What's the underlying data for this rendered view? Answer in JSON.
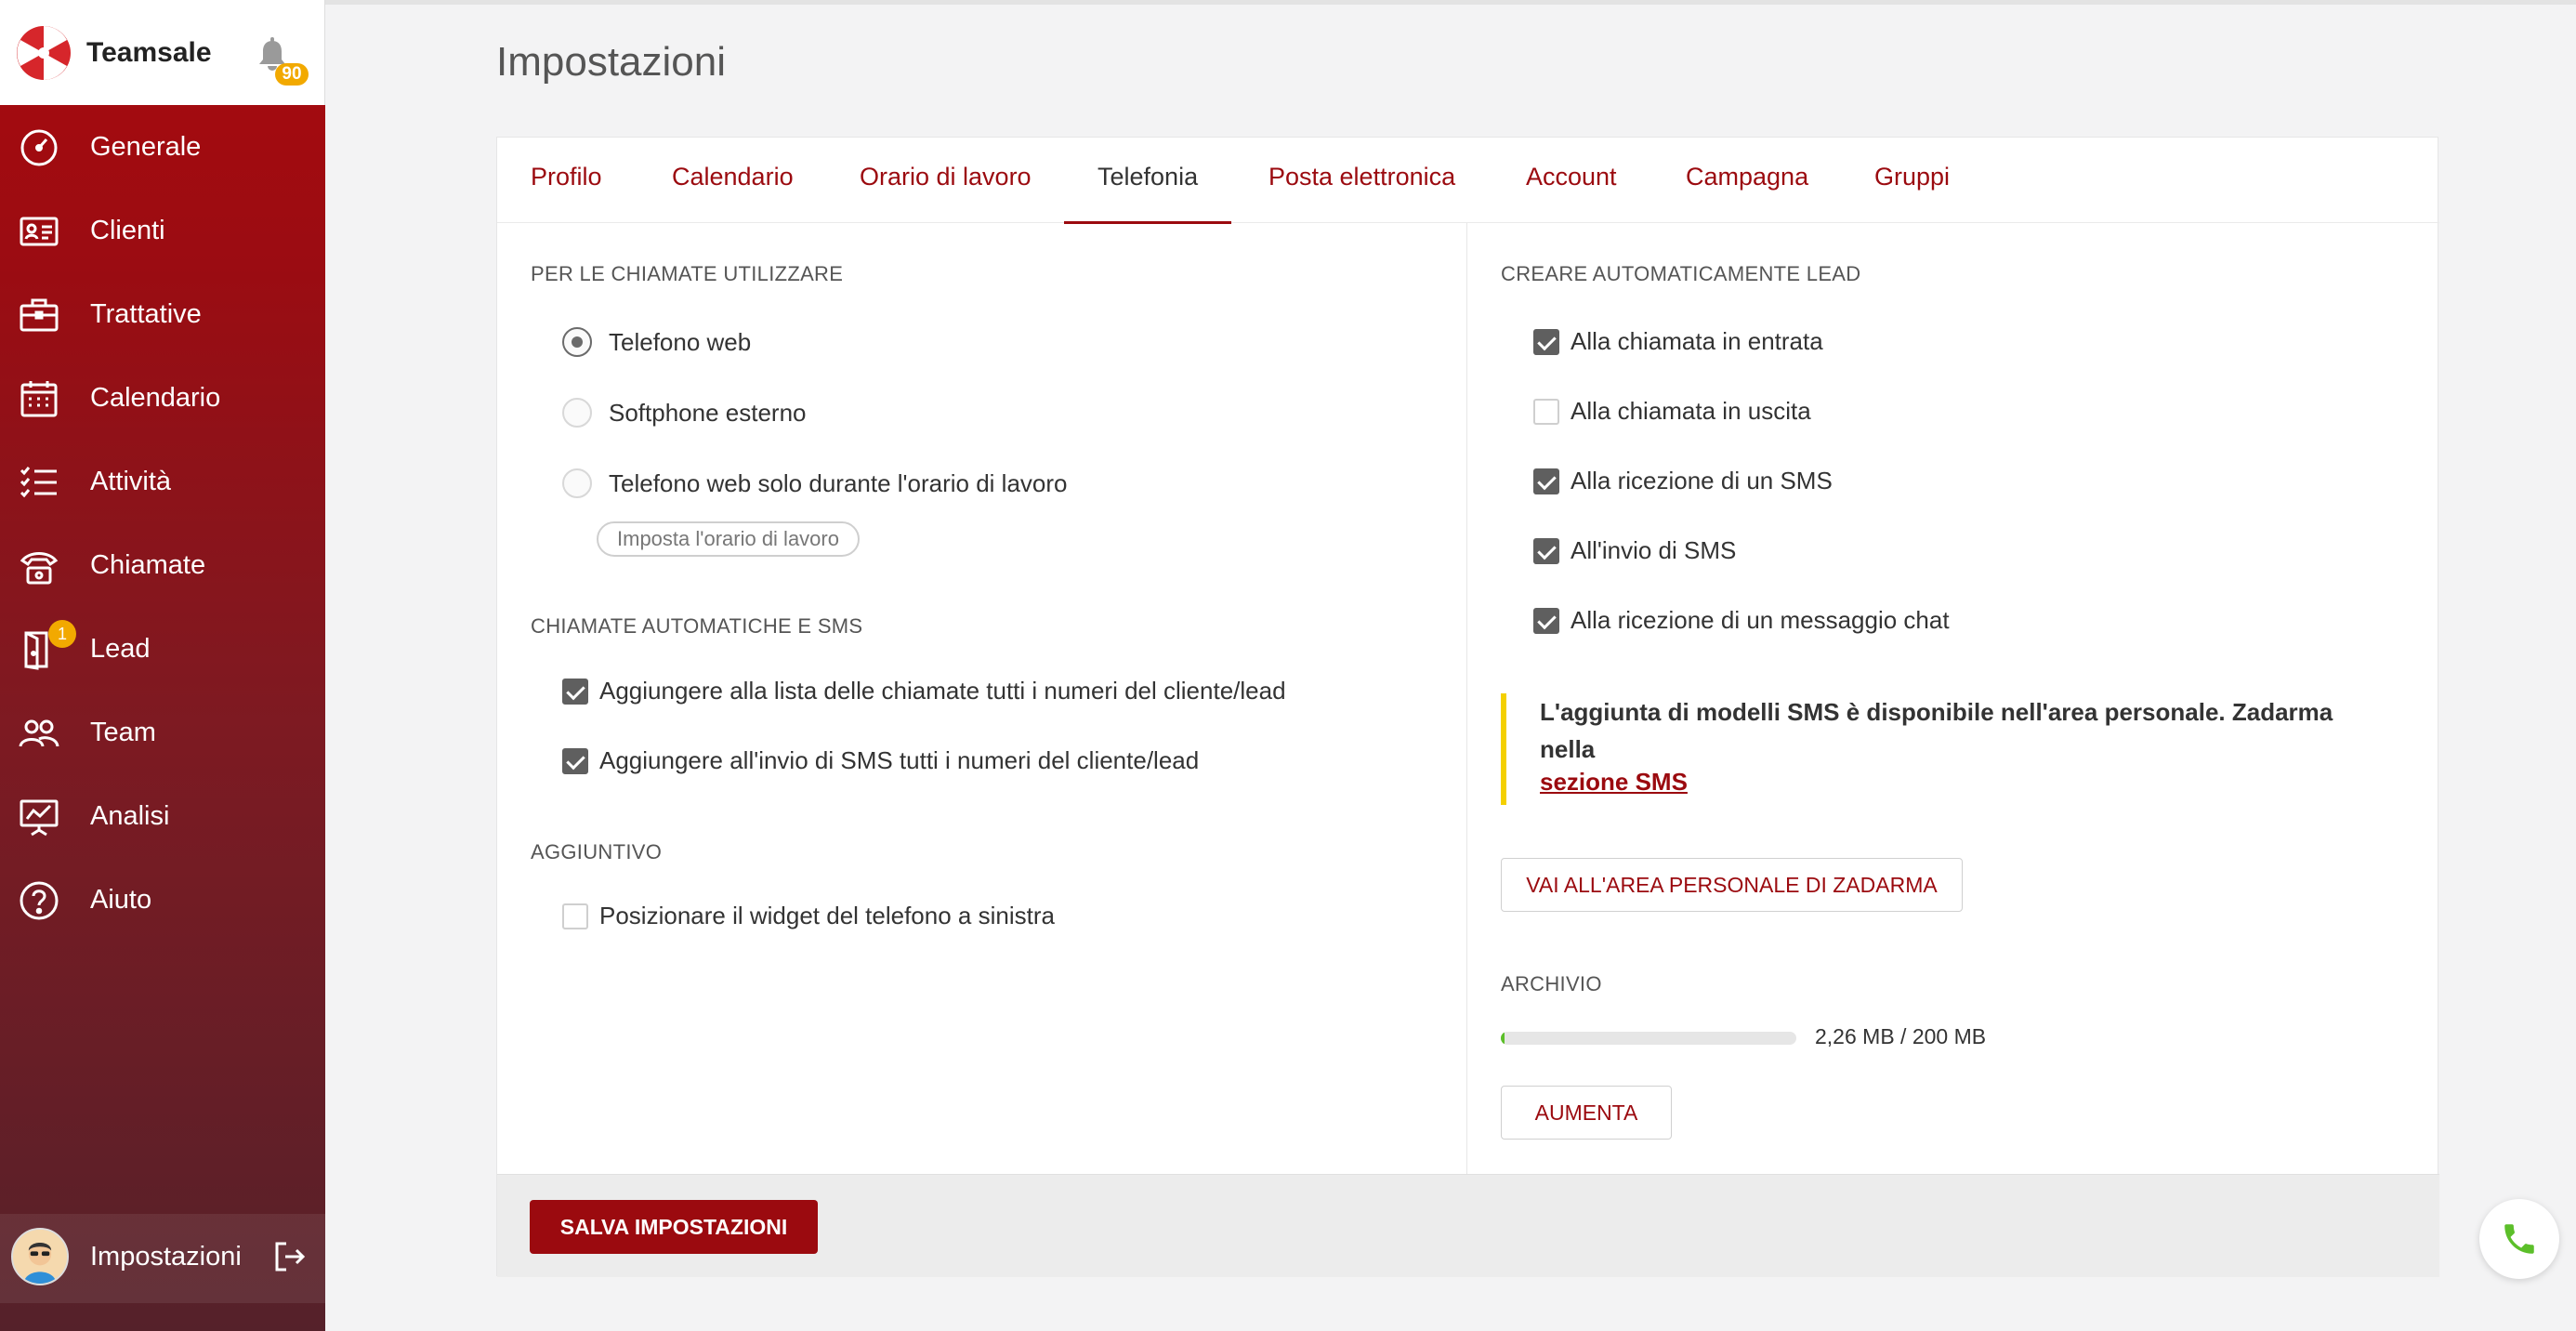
{
  "brand": {
    "name": "Teamsale",
    "notifications_count": "90"
  },
  "sidebar": {
    "items": [
      {
        "label": "Generale",
        "icon": "dashboard-icon"
      },
      {
        "label": "Clienti",
        "icon": "contact-card-icon"
      },
      {
        "label": "Trattative",
        "icon": "briefcase-icon"
      },
      {
        "label": "Calendario",
        "icon": "calendar-icon"
      },
      {
        "label": "Attività",
        "icon": "checklist-icon"
      },
      {
        "label": "Chiamate",
        "icon": "phone-icon"
      },
      {
        "label": "Lead",
        "icon": "door-icon",
        "badge": "1"
      },
      {
        "label": "Team",
        "icon": "team-icon"
      },
      {
        "label": "Analisi",
        "icon": "analytics-icon"
      },
      {
        "label": "Aiuto",
        "icon": "help-icon"
      }
    ],
    "footer": {
      "label": "Impostazioni"
    }
  },
  "page": {
    "title": "Impostazioni"
  },
  "tabs": [
    {
      "label": "Profilo",
      "active": false
    },
    {
      "label": "Calendario",
      "active": false
    },
    {
      "label": "Orario di lavoro",
      "active": false
    },
    {
      "label": "Telefonia",
      "active": true
    },
    {
      "label": "Posta elettronica",
      "active": false
    },
    {
      "label": "Account",
      "active": false
    },
    {
      "label": "Campagna",
      "active": false
    },
    {
      "label": "Gruppi",
      "active": false
    }
  ],
  "left": {
    "calls_section": {
      "title": "Per le chiamate utilizzare",
      "options": [
        {
          "label": "Telefono web",
          "selected": true
        },
        {
          "label": "Softphone esterno",
          "selected": false
        },
        {
          "label": "Telefono web solo durante l'orario di lavoro",
          "selected": false
        }
      ],
      "set_hours_button": "Imposta l'orario di lavoro"
    },
    "auto_section": {
      "title": "Chiamate automatiche e SMS",
      "options": [
        {
          "label": "Aggiungere alla lista delle chiamate tutti i numeri del cliente/lead",
          "checked": true
        },
        {
          "label": "Aggiungere all'invio di SMS tutti i numeri del cliente/lead",
          "checked": true
        }
      ]
    },
    "extra_section": {
      "title": "Aggiuntivo",
      "options": [
        {
          "label": "Posizionare il widget del telefono a sinistra",
          "checked": false
        }
      ]
    }
  },
  "right": {
    "lead_section": {
      "title": "Creare automaticamente lead",
      "options": [
        {
          "label": "Alla chiamata in entrata",
          "checked": true
        },
        {
          "label": "Alla chiamata in uscita",
          "checked": false
        },
        {
          "label": "Alla ricezione di un SMS",
          "checked": true
        },
        {
          "label": "All'invio di SMS",
          "checked": true
        },
        {
          "label": "Alla ricezione di un messaggio chat",
          "checked": true
        }
      ]
    },
    "notice": {
      "text": "L'aggiunta di modelli SMS è disponibile nell'area personale. Zadarma nella",
      "link": "sezione SMS"
    },
    "personal_area_button": "Vai all'area personale di Zadarma",
    "archive": {
      "title": "Archivio",
      "used_fraction": 0.0113,
      "usage_text": "2,26 MB / 200 MB",
      "increase_button": "Aumenta"
    }
  },
  "footer": {
    "save_button": "Salva impostazioni"
  },
  "colors": {
    "accent": "#9b0a0f",
    "badge": "#f2a900",
    "progress": "#5cbf2a",
    "notice_border": "#f4d000",
    "phone": "#5cbf2a"
  }
}
